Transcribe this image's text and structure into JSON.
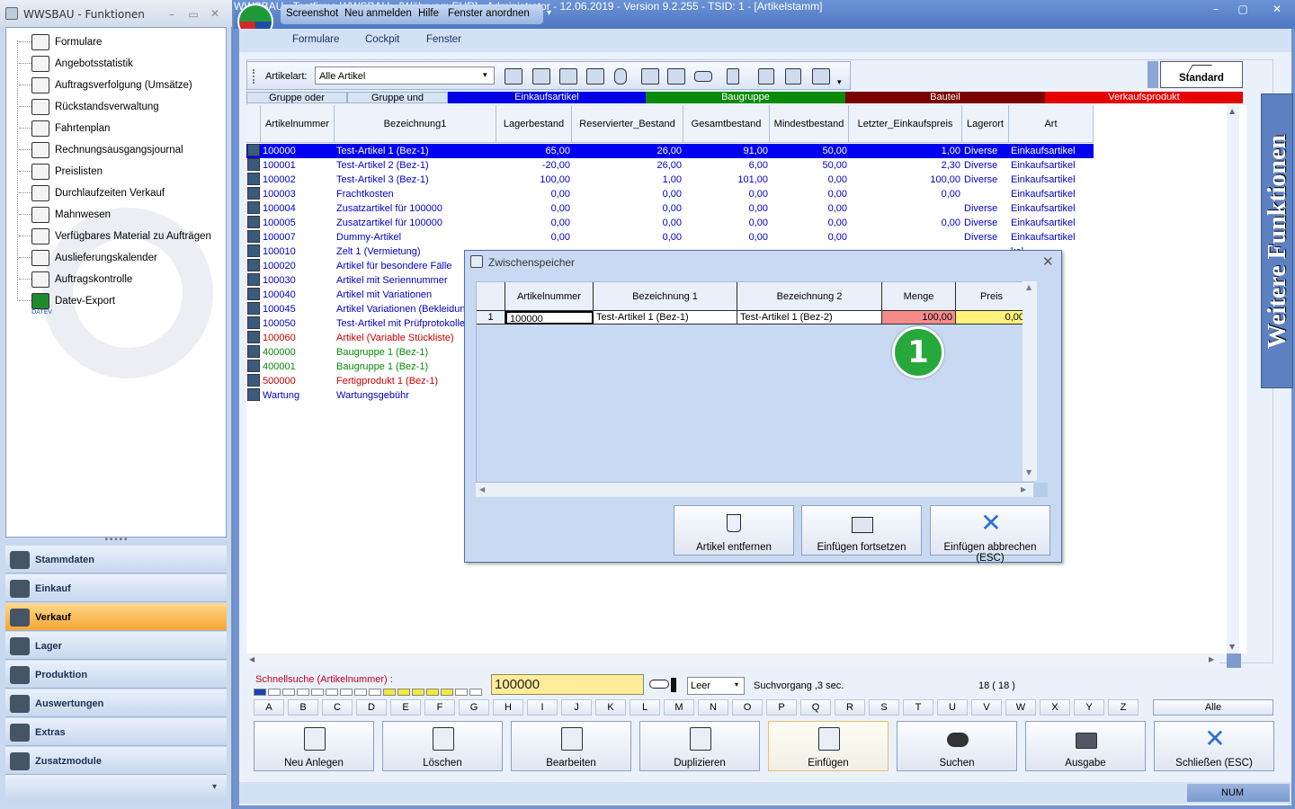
{
  "left_window": {
    "title": "WWSBAU - Funktionen",
    "functions": [
      "Formulare",
      "Angebotsstatistik",
      "Auftragsverfolgung (Umsätze)",
      "Rückstandsverwaltung",
      "Fahrtenplan",
      "Rechnungsausgangsjournal",
      "Preislisten",
      "Durchlaufzeiten Verkauf",
      "Mahnwesen",
      "Verfügbares Material zu Aufträgen",
      "Auslieferungskalender",
      "Auftragskontrolle",
      "Datev-Export"
    ],
    "datev_caption": "DATEV",
    "nav": [
      "Stammdaten",
      "Einkauf",
      "Verkauf",
      "Lager",
      "Produktion",
      "Auswertungen",
      "Extras",
      "Zusatzmodule"
    ],
    "active_nav": "Verkauf"
  },
  "main_window": {
    "quick_menu": [
      "Screenshot",
      "Neu anmelden",
      "Hilfe",
      "Fenster anordnen"
    ],
    "title": "WWSBAU - Testfirma WWSBAU - [Währung: EUR] - Administrator - 12.06.2019 - Version 9.2.255 - TSID: 1 - [Artikelstamm]",
    "menu": [
      "Formulare",
      "Cockpit",
      "Fenster"
    ]
  },
  "toolbar": {
    "artikelart_label": "Artikelart:",
    "artikelart_value": "Alle Artikel",
    "standard_label": "Standard"
  },
  "legend": [
    {
      "label": "Gruppe oder",
      "color": "#d8e4f4",
      "text": "#000000"
    },
    {
      "label": "Gruppe und",
      "color": "#d8e4f4",
      "text": "#000000"
    },
    {
      "label": "Einkaufsartikel",
      "color": "#0000e6",
      "text": "#ffffff"
    },
    {
      "label": "Baugruppe",
      "color": "#0a8a0a",
      "text": "#ffffff"
    },
    {
      "label": "Bauteil",
      "color": "#7a0000",
      "text": "#ffffff"
    },
    {
      "label": "Verkaufsprodukt",
      "color": "#e60000",
      "text": "#ffffff"
    }
  ],
  "grid": {
    "columns": [
      "Artikelnummer",
      "Bezeichnung1",
      "Lagerbestand",
      "Reservierter_Bestand",
      "Gesamtbestand",
      "Mindestbestand",
      "Letzter_Einkaufspreis",
      "Lagerort",
      "Art"
    ],
    "rows": [
      [
        "100000",
        "Test-Artikel 1  (Bez-1)",
        "65,00",
        "26,00",
        "91,00",
        "50,00",
        "1,00",
        "Diverse",
        "Einkaufsartikel"
      ],
      [
        "100001",
        "Test-Artikel 2  (Bez-1)",
        "-20,00",
        "26,00",
        "6,00",
        "50,00",
        "2,30",
        "Diverse",
        "Einkaufsartikel"
      ],
      [
        "100002",
        "Test-Artikel 3  (Bez-1)",
        "100,00",
        "1,00",
        "101,00",
        "0,00",
        "100,00",
        "Diverse",
        "Einkaufsartikel"
      ],
      [
        "100003",
        "Frachtkosten",
        "0,00",
        "0,00",
        "0,00",
        "0,00",
        "0,00",
        "",
        "Einkaufsartikel"
      ],
      [
        "100004",
        "Zusatzartikel für 100000",
        "0,00",
        "0,00",
        "0,00",
        "0,00",
        "",
        "Diverse",
        "Einkaufsartikel"
      ],
      [
        "100005",
        "Zusatzartikel für 100000",
        "0,00",
        "0,00",
        "0,00",
        "0,00",
        "0,00",
        "Diverse",
        "Einkaufsartikel"
      ],
      [
        "100007",
        "Dummy-Artikel",
        "0,00",
        "0,00",
        "0,00",
        "0,00",
        "",
        "Diverse",
        "Einkaufsartikel"
      ],
      [
        "100010",
        "Zelt 1 (Vermietung)",
        "",
        "",
        "",
        "",
        "",
        "",
        "kel"
      ],
      [
        "100020",
        "Artikel für besondere Fälle",
        "",
        "",
        "",
        "",
        "",
        "",
        "kel"
      ],
      [
        "100030",
        "Artikel mit Seriennummer",
        "",
        "",
        "",
        "",
        "",
        "",
        "kel"
      ],
      [
        "100040",
        "Artikel mit Variationen",
        "",
        "",
        "",
        "",
        "",
        "",
        "kel"
      ],
      [
        "100045",
        "Artikel Variationen (Bekleidung",
        "",
        "",
        "",
        "",
        "",
        "",
        "kel"
      ],
      [
        "100050",
        "Test-Artikel mit Prüfprotokollen",
        "",
        "",
        "",
        "",
        "",
        "",
        "kel"
      ],
      [
        "100060",
        "Artikel (Variable Stückliste)",
        "",
        "",
        "",
        "",
        "",
        "",
        "odukt"
      ],
      [
        "400000",
        "Baugruppe 1  (Bez-1)",
        "",
        "",
        "",
        "",
        "",
        "",
        ""
      ],
      [
        "400001",
        "Baugruppe 1  (Bez-1)",
        "",
        "",
        "",
        "",
        "",
        "",
        ""
      ],
      [
        "500000",
        "Fertigprodukt 1  (Bez-1)",
        "",
        "",
        "",
        "",
        "",
        "",
        "odukt"
      ],
      [
        "Wartung",
        "Wartungsgebühr",
        "",
        "",
        "",
        "",
        "",
        "",
        "kel"
      ]
    ],
    "row_colors": [
      "#ffffff",
      "#0000c8",
      "#0000c8",
      "#0000c8",
      "#0000c8",
      "#0000c8",
      "#0000c8",
      "#0000c8",
      "#0000c8",
      "#0000c8",
      "#0000c8",
      "#0000c8",
      "#0000c8",
      "#c80000",
      "#0a8a0a",
      "#0a8a0a",
      "#c80000",
      "#0000c8"
    ]
  },
  "side_panel": {
    "label": "Weitere Funktionen"
  },
  "dialog": {
    "title": "Zwischenspeicher",
    "columns": [
      "Artikelnummer",
      "Bezeichnung 1",
      "Bezeichnung 2",
      "Menge",
      "Preis"
    ],
    "row": {
      "index": "1",
      "artikelnummer": "100000",
      "bez1": "Test-Artikel 1  (Bez-1)",
      "bez2": "Test-Artikel 1  (Bez-2)",
      "menge": "100,00",
      "preis": "0,00"
    },
    "buttons": [
      "Artikel entfernen",
      "Einfügen fortsetzen",
      "Einfügen abbrechen (ESC)"
    ],
    "marker": "1"
  },
  "search": {
    "label": "Schnellsuche (Artikelnummer) :",
    "value": "100000",
    "mode": "Leer",
    "status": "Suchvorgang ,3 sec.",
    "count": "18  ( 18 )"
  },
  "alphabet": [
    "A",
    "B",
    "C",
    "D",
    "E",
    "F",
    "G",
    "H",
    "I",
    "J",
    "K",
    "L",
    "M",
    "N",
    "O",
    "P",
    "Q",
    "R",
    "S",
    "T",
    "U",
    "V",
    "W",
    "X",
    "Y",
    "Z"
  ],
  "alle_label": "Alle",
  "actions": [
    "Neu Anlegen",
    "Löschen",
    "Bearbeiten",
    "Duplizieren",
    "Einfügen",
    "Suchen",
    "Ausgabe",
    "Schließen (ESC)"
  ],
  "statusbar": {
    "num": "NUM"
  }
}
